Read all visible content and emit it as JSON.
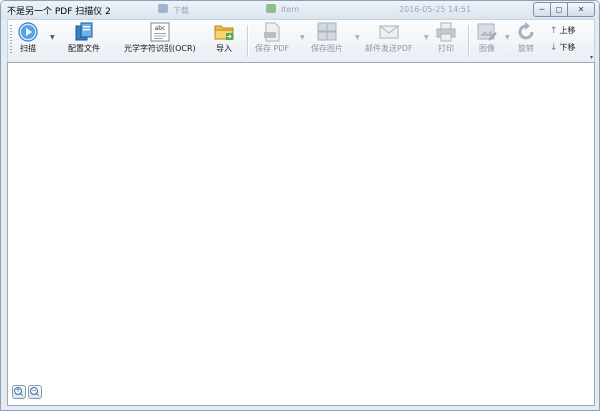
{
  "window": {
    "title": "不是另一个 PDF 扫描仪 2",
    "background_texts": [
      "下载",
      "Item",
      "2016-05-25 14:51"
    ]
  },
  "window_controls": [
    "─",
    "◻",
    "✕"
  ],
  "toolbar": {
    "items": [
      {
        "id": "scan",
        "label": "扫描",
        "icon": "scan-play-icon",
        "enabled": true,
        "dropdown": true
      },
      {
        "id": "profiles",
        "label": "配置文件",
        "icon": "profiles-icon",
        "enabled": true,
        "dropdown": false
      },
      {
        "id": "ocr",
        "label": "光学字符识别(OCR)",
        "icon": "ocr-icon",
        "icon_text": "abc",
        "enabled": true,
        "dropdown": false
      },
      {
        "id": "import",
        "label": "导入",
        "icon": "import-folder-icon",
        "enabled": true,
        "dropdown": false
      },
      {
        "id": "save_pdf",
        "label": "保存 PDF",
        "icon": "pdf-file-icon",
        "enabled": false,
        "dropdown": true
      },
      {
        "id": "save_images",
        "label": "保存图片",
        "icon": "images-icon",
        "enabled": false,
        "dropdown": true
      },
      {
        "id": "email_pdf",
        "label": "邮件发送PDF",
        "icon": "email-icon",
        "enabled": false,
        "dropdown": true
      },
      {
        "id": "print",
        "label": "打印",
        "icon": "printer-icon",
        "enabled": false,
        "dropdown": false
      },
      {
        "id": "image",
        "label": "图像",
        "icon": "image-edit-icon",
        "enabled": false,
        "dropdown": true
      },
      {
        "id": "rotate",
        "label": "旋转",
        "icon": "rotate-icon",
        "enabled": false,
        "dropdown": false
      }
    ],
    "move_up": "上移",
    "move_down": "下移"
  },
  "colors": {
    "window_border": "#8aa0b8",
    "toolbar_bg": "#eef2f7",
    "scan_blue": "#2f7fd1",
    "folder_yellow": "#f0c04a",
    "disabled_gray": "#a9b2bc"
  }
}
